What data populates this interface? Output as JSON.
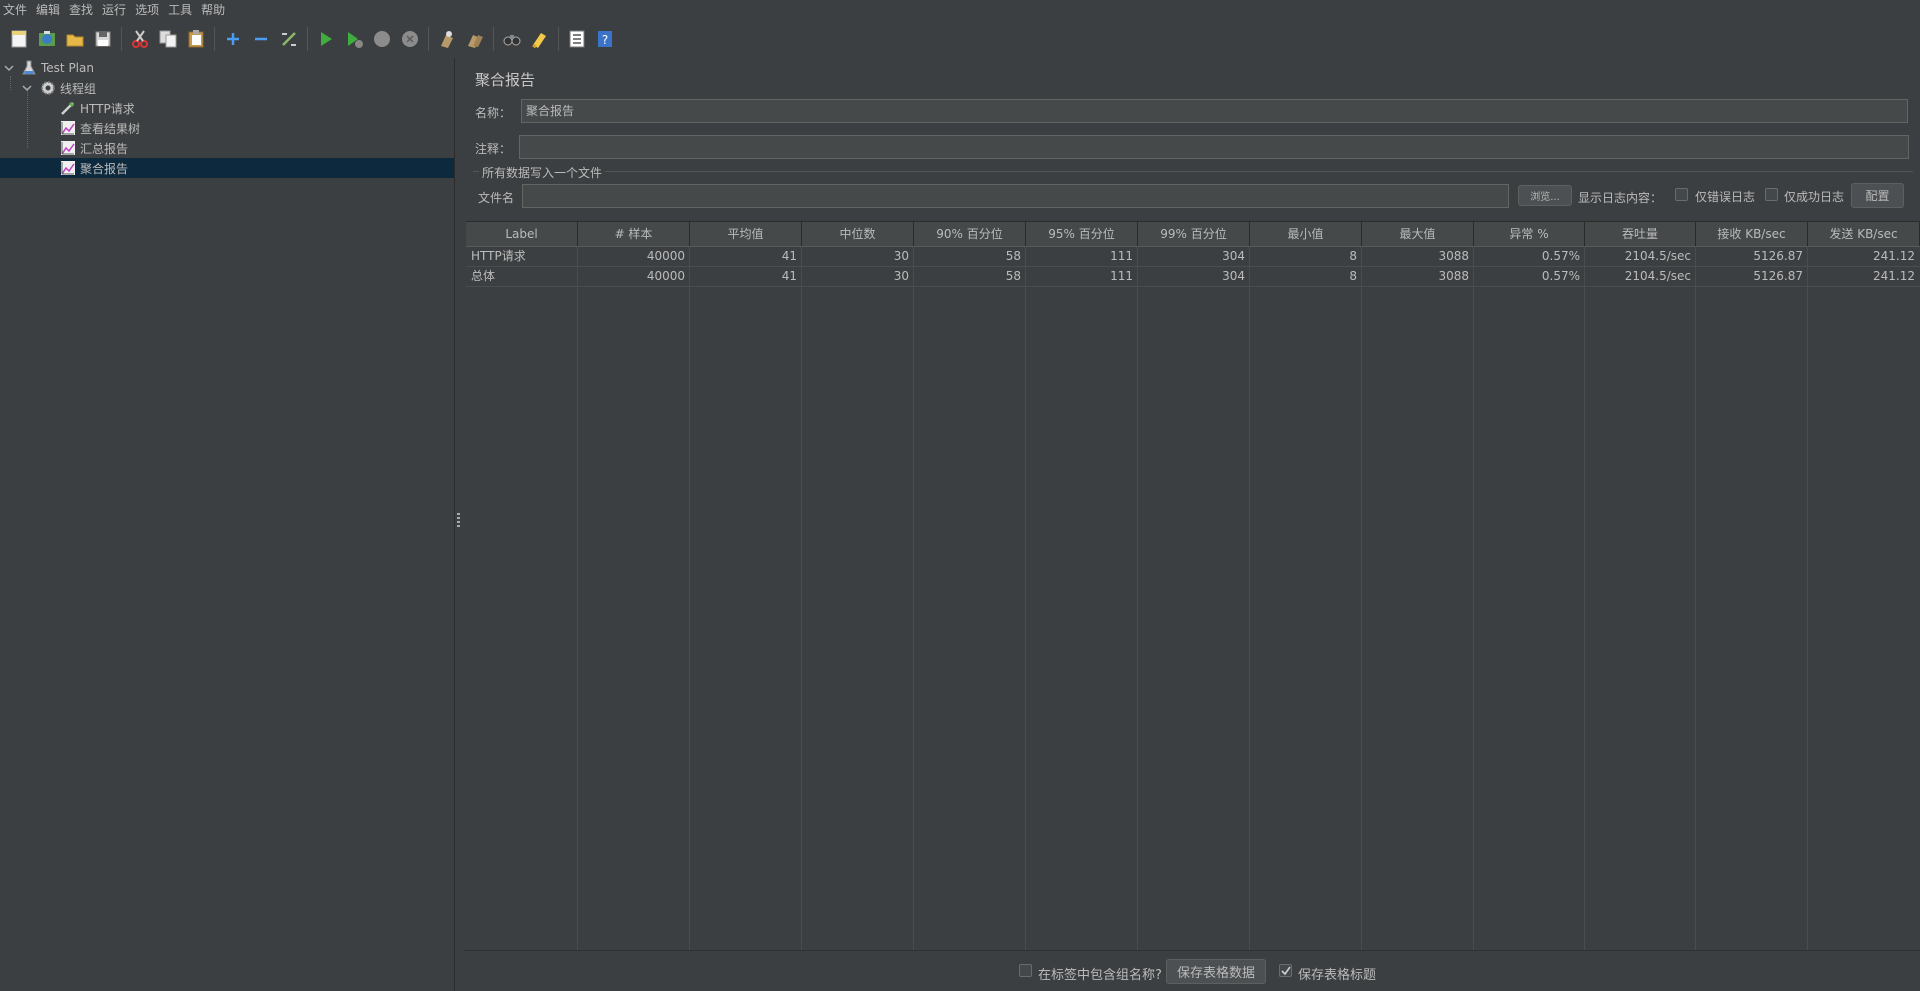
{
  "menubar": {
    "items": [
      "文件",
      "编辑",
      "查找",
      "运行",
      "选项",
      "工具",
      "帮助"
    ]
  },
  "toolbar": {
    "icons": [
      "new-icon",
      "templates-icon",
      "open-icon",
      "save-icon",
      "cut-icon",
      "copy-icon",
      "paste-icon",
      "expand-icon",
      "collapse-icon",
      "toggle-icon",
      "start-icon",
      "start-no-pauses-icon",
      "stop-icon",
      "shutdown-icon",
      "clear-icon",
      "clear-all-icon",
      "search-icon",
      "reset-search-icon",
      "function-helper-icon",
      "help-icon"
    ]
  },
  "tree": {
    "nodes": [
      {
        "label": "Test Plan",
        "icon": "flask-icon"
      },
      {
        "label": "线程组",
        "icon": "gear-icon"
      },
      {
        "label": "HTTP请求",
        "icon": "sampler-icon"
      },
      {
        "label": "查看结果树",
        "icon": "listener-icon"
      },
      {
        "label": "汇总报告",
        "icon": "listener-icon"
      },
      {
        "label": "聚合报告",
        "icon": "listener-icon",
        "selected": true
      }
    ]
  },
  "panel": {
    "title": "聚合报告",
    "name_label": "名称：",
    "name_value": "聚合报告",
    "comment_label": "注释：",
    "comment_value": "",
    "file_group_title": "所有数据写入一个文件",
    "filename_label": "文件名",
    "filename_value": "",
    "browse_label": "浏览...",
    "log_content_label": "显示日志内容：",
    "errors_only_label": "仅错误日志",
    "success_only_label": "仅成功日志",
    "configure_label": "配置"
  },
  "table": {
    "columns": [
      "Label",
      "# 样本",
      "平均值",
      "中位数",
      "90% 百分位",
      "95% 百分位",
      "99% 百分位",
      "最小值",
      "最大值",
      "异常 %",
      "吞吐量",
      "接收 KB/sec",
      "发送 KB/sec"
    ],
    "rows": [
      [
        "HTTP请求",
        "40000",
        "41",
        "30",
        "58",
        "111",
        "304",
        "8",
        "3088",
        "0.57%",
        "2104.5/sec",
        "5126.87",
        "241.12"
      ],
      [
        "总体",
        "40000",
        "41",
        "30",
        "58",
        "111",
        "304",
        "8",
        "3088",
        "0.57%",
        "2104.5/sec",
        "5126.87",
        "241.12"
      ]
    ]
  },
  "bottom": {
    "include_group_label": "在标签中包含组名称?",
    "include_group_checked": false,
    "save_table_button": "保存表格数据",
    "save_header_label": "保存表格标题",
    "save_header_checked": true
  }
}
